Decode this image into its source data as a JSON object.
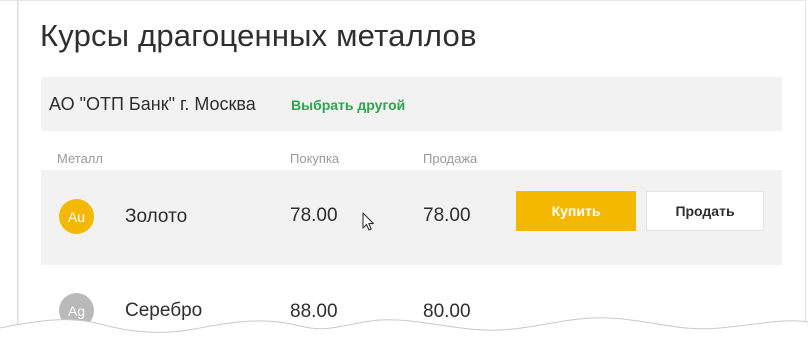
{
  "page": {
    "title": "Курсы драгоценных металлов"
  },
  "bank": {
    "name": "АО \"ОТП Банк\" г. Москва",
    "change_link": "Выбрать другой"
  },
  "table": {
    "headers": {
      "metal": "Металл",
      "buy": "Покупка",
      "sell": "Продажа"
    },
    "rows": [
      {
        "symbol": "Au",
        "name": "Золото",
        "buy": "78.00",
        "sell": "78.00",
        "buy_button": "Купить",
        "sell_button": "Продать",
        "color": "#f5b800"
      },
      {
        "symbol": "Ag",
        "name": "Серебро",
        "buy": "88.00",
        "sell": "80.00",
        "color": "#b9b9b9"
      }
    ]
  },
  "colors": {
    "accent": "#f5b800",
    "link": "#2da44e",
    "row_bg": "#f2f2f2"
  },
  "icons": {
    "cursor": "mouse-pointer-icon"
  }
}
